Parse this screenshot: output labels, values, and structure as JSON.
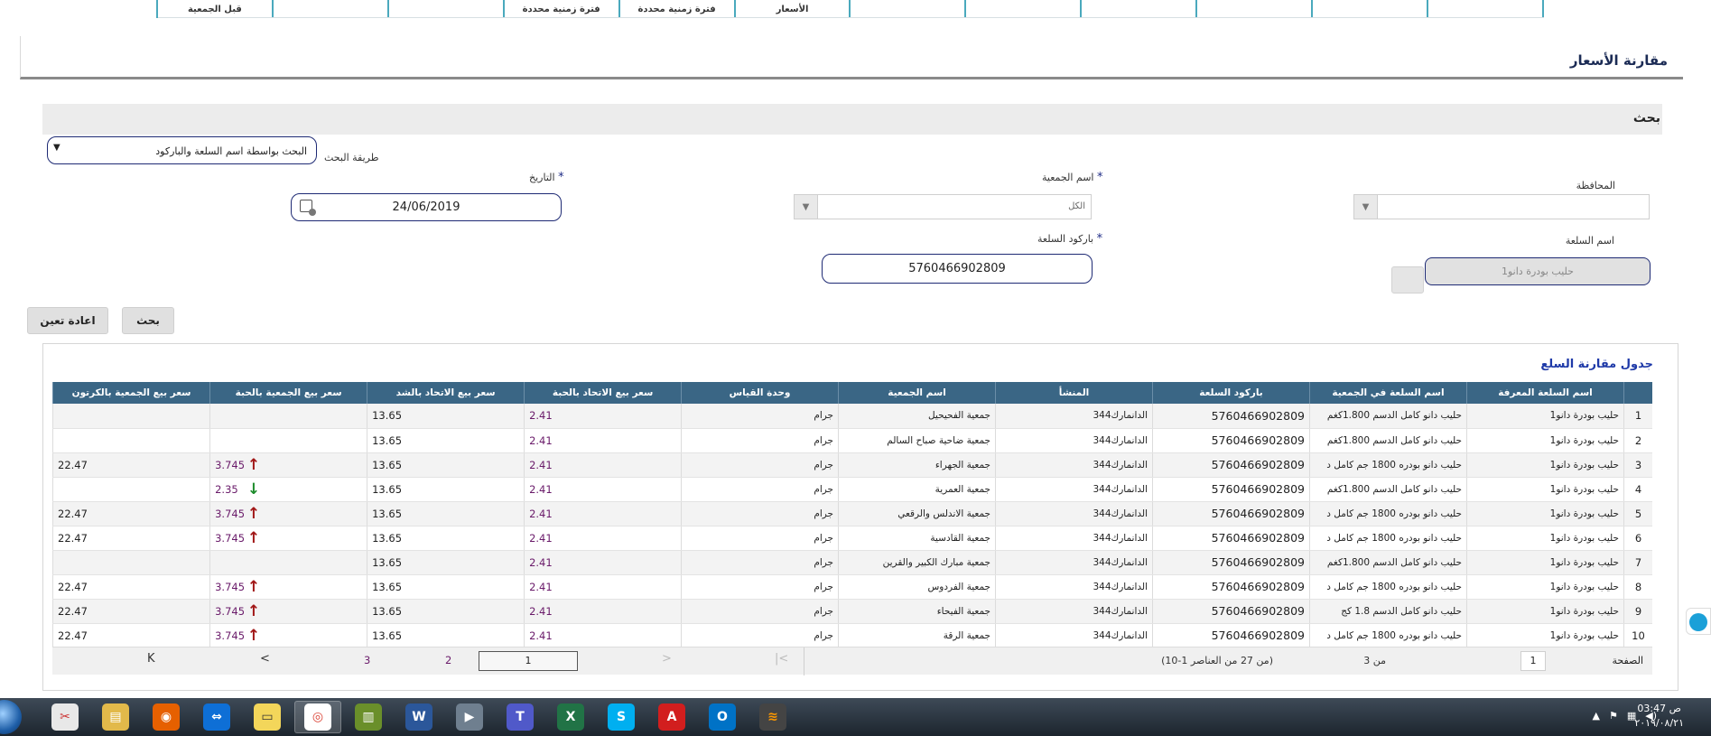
{
  "top_tabs": [
    "",
    "",
    "",
    "",
    "",
    "",
    "الأسعار",
    "فترة زمنية محددة",
    "فترة زمنية محددة",
    "",
    "",
    "قبل الجمعية"
  ],
  "page": {
    "title": "مقارنة الأسعار"
  },
  "search": {
    "section_title": "بحث",
    "method_label": "طريقة البحث",
    "method_value": "البحث بواسطة اسم السلعة والباركود",
    "governorate_label": "المحافظة",
    "governorate_value": "",
    "association_label": "اسم الجمعية",
    "association_value": "الكل",
    "date_label": "التاريخ",
    "date_value": "24/06/2019",
    "item_name_label": "اسم السلعة",
    "item_name_value": "حليب بودرة دانو1",
    "barcode_label": "باركود السلعة",
    "barcode_value": "5760466902809",
    "required_mark": "*",
    "search_button": "بحث",
    "reset_button": "اعادة تعين"
  },
  "table": {
    "title": "جدول مقارنة السلع",
    "columns": [
      "اسم السلعة المعرفة",
      "اسم السلعة في الجمعية",
      "باركود السلعة",
      "المنشأ",
      "اسم الجمعية",
      "وحدة القياس",
      "سعر بيع الاتحاد بالحبة",
      "سعر بيع الاتحاد بالشد",
      "سعر بيع الجمعية بالحبة",
      "سعر بيع الجمعية بالكرتون"
    ],
    "rows": [
      {
        "n": "1",
        "name": "حليب بودرة دانو1",
        "item": "حليب دانو كامل الدسم 1.800كغم",
        "barcode": "5760466902809",
        "origin": "الدانمارك344",
        "assoc": "جمعية الفحيحيل",
        "unit": "جرام",
        "pu": "2.41",
        "pc": "13.65",
        "au": "",
        "ac": "",
        "trend": ""
      },
      {
        "n": "2",
        "name": "حليب بودرة دانو1",
        "item": "حليب دانو كامل الدسم 1.800كغم",
        "barcode": "5760466902809",
        "origin": "الدانمارك344",
        "assoc": "جمعية ضاحية صباح السالم",
        "unit": "جرام",
        "pu": "2.41",
        "pc": "13.65",
        "au": "",
        "ac": "",
        "trend": ""
      },
      {
        "n": "3",
        "name": "حليب بودرة دانو1",
        "item": "حليب دانو بودره 1800 جم كامل د",
        "barcode": "5760466902809",
        "origin": "الدانمارك344",
        "assoc": "جمعية الجهراء",
        "unit": "جرام",
        "pu": "2.41",
        "pc": "13.65",
        "au": "3.745",
        "ac": "22.47",
        "trend": "up"
      },
      {
        "n": "4",
        "name": "حليب بودرة دانو1",
        "item": "حليب دانو كامل الدسم 1.800كغم",
        "barcode": "5760466902809",
        "origin": "الدانمارك344",
        "assoc": "جمعية العمرية",
        "unit": "جرام",
        "pu": "2.41",
        "pc": "13.65",
        "au": "2.35",
        "ac": "",
        "trend": "down"
      },
      {
        "n": "5",
        "name": "حليب بودرة دانو1",
        "item": "حليب دانو بودره 1800 جم كامل د",
        "barcode": "5760466902809",
        "origin": "الدانمارك344",
        "assoc": "جمعية الاندلس والرقعي",
        "unit": "جرام",
        "pu": "2.41",
        "pc": "13.65",
        "au": "3.745",
        "ac": "22.47",
        "trend": "up"
      },
      {
        "n": "6",
        "name": "حليب بودرة دانو1",
        "item": "حليب دانو بودره 1800 جم كامل د",
        "barcode": "5760466902809",
        "origin": "الدانمارك344",
        "assoc": "جمعية القادسية",
        "unit": "جرام",
        "pu": "2.41",
        "pc": "13.65",
        "au": "3.745",
        "ac": "22.47",
        "trend": "up"
      },
      {
        "n": "7",
        "name": "حليب بودرة دانو1",
        "item": "حليب دانو كامل الدسم 1.800كغم",
        "barcode": "5760466902809",
        "origin": "الدانمارك344",
        "assoc": "جمعية مبارك الكبير والقرين",
        "unit": "جرام",
        "pu": "2.41",
        "pc": "13.65",
        "au": "",
        "ac": "",
        "trend": ""
      },
      {
        "n": "8",
        "name": "حليب بودرة دانو1",
        "item": "حليب دانو بودره 1800 جم كامل د",
        "barcode": "5760466902809",
        "origin": "الدانمارك344",
        "assoc": "جمعية الفردوس",
        "unit": "جرام",
        "pu": "2.41",
        "pc": "13.65",
        "au": "3.745",
        "ac": "22.47",
        "trend": "up"
      },
      {
        "n": "9",
        "name": "حليب بودرة دانو1",
        "item": "حليب دانو كامل الدسم 1.8 كج",
        "barcode": "5760466902809",
        "origin": "الدانمارك344",
        "assoc": "جمعية الفيحاء",
        "unit": "جرام",
        "pu": "2.41",
        "pc": "13.65",
        "au": "3.745",
        "ac": "22.47",
        "trend": "up"
      },
      {
        "n": "10",
        "name": "حليب بودرة دانو1",
        "item": "حليب دانو بودره 1800 جم كامل د",
        "barcode": "5760466902809",
        "origin": "الدانمارك344",
        "assoc": "جمعية الرقة",
        "unit": "جرام",
        "pu": "2.41",
        "pc": "13.65",
        "au": "3.745",
        "ac": "22.47",
        "trend": "up"
      }
    ]
  },
  "pager": {
    "page_label": "الصفحة",
    "current_page": "1",
    "of_label": "من 3",
    "info": "(10-1 من 27 من العناصر)",
    "page_box": "1",
    "page_2": "2",
    "page_3": "3",
    "next_glyph": "<",
    "last_glyph": "K"
  },
  "taskbar": {
    "apps": [
      "snipping-tool",
      "file-explorer",
      "firefox",
      "teamviewer",
      "notes",
      "chrome",
      "excel-chart",
      "word",
      "media",
      "teams",
      "excel",
      "skype",
      "acrobat",
      "outlook",
      "app"
    ],
    "clock_time": "ص 03:47",
    "clock_date": "٢٠١٩/٠٨/٢١"
  }
}
